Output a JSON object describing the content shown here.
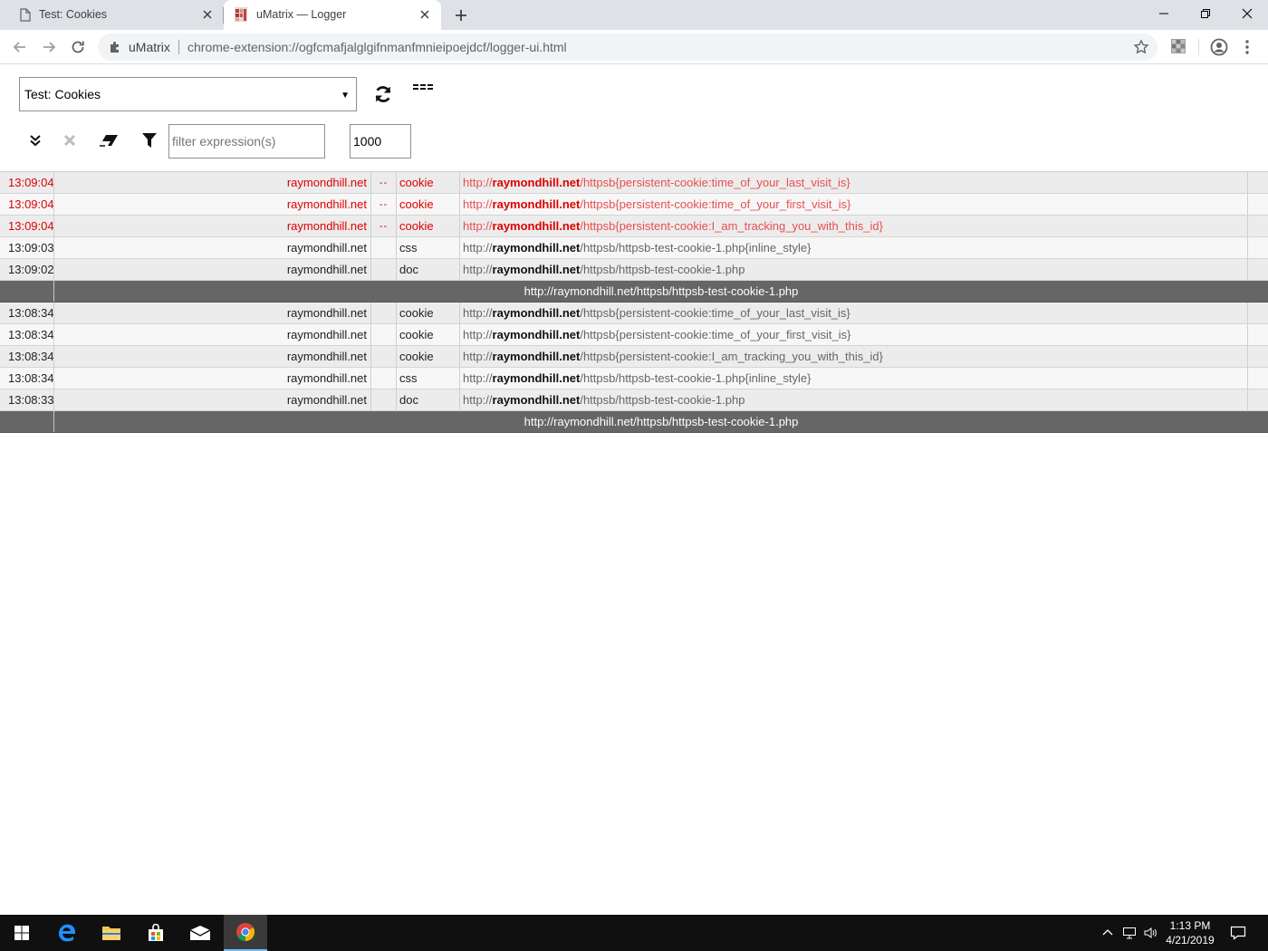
{
  "browser": {
    "tabs": [
      {
        "title": "Test: Cookies",
        "active": false
      },
      {
        "title": "uMatrix — Logger",
        "active": true
      }
    ],
    "omnibox": {
      "site_name": "uMatrix",
      "url": "chrome-extension://ogfcmafjalglgifnmanfmnieipoejdcf/logger-ui.html"
    }
  },
  "logger": {
    "tab_selector": {
      "selected": "Test: Cookies"
    },
    "filter": {
      "placeholder": "filter expression(s)",
      "value": ""
    },
    "max_entries": "1000",
    "rows": [
      {
        "kind": "entry",
        "blocked": true,
        "time": "13:09:04",
        "host": "raymondhill.net",
        "flag": "--",
        "type": "cookie",
        "url_scheme": "http://",
        "url_host": "raymondhill.net",
        "url_path": "/httpsb{persistent-cookie:time_of_your_last_visit_is}"
      },
      {
        "kind": "entry",
        "blocked": true,
        "time": "13:09:04",
        "host": "raymondhill.net",
        "flag": "--",
        "type": "cookie",
        "url_scheme": "http://",
        "url_host": "raymondhill.net",
        "url_path": "/httpsb{persistent-cookie:time_of_your_first_visit_is}"
      },
      {
        "kind": "entry",
        "blocked": true,
        "time": "13:09:04",
        "host": "raymondhill.net",
        "flag": "--",
        "type": "cookie",
        "url_scheme": "http://",
        "url_host": "raymondhill.net",
        "url_path": "/httpsb{persistent-cookie:I_am_tracking_you_with_this_id}"
      },
      {
        "kind": "entry",
        "blocked": false,
        "time": "13:09:03",
        "host": "raymondhill.net",
        "flag": "",
        "type": "css",
        "url_scheme": "http://",
        "url_host": "raymondhill.net",
        "url_path": "/httpsb/httpsb-test-cookie-1.php{inline_style}"
      },
      {
        "kind": "entry",
        "blocked": false,
        "time": "13:09:02",
        "host": "raymondhill.net",
        "flag": "",
        "type": "doc",
        "url_scheme": "http://",
        "url_host": "raymondhill.net",
        "url_path": "/httpsb/httpsb-test-cookie-1.php"
      },
      {
        "kind": "doc",
        "url": "http://raymondhill.net/httpsb/httpsb-test-cookie-1.php"
      },
      {
        "kind": "entry",
        "blocked": false,
        "time": "13:08:34",
        "host": "raymondhill.net",
        "flag": "",
        "type": "cookie",
        "url_scheme": "http://",
        "url_host": "raymondhill.net",
        "url_path": "/httpsb{persistent-cookie:time_of_your_last_visit_is}"
      },
      {
        "kind": "entry",
        "blocked": false,
        "time": "13:08:34",
        "host": "raymondhill.net",
        "flag": "",
        "type": "cookie",
        "url_scheme": "http://",
        "url_host": "raymondhill.net",
        "url_path": "/httpsb{persistent-cookie:time_of_your_first_visit_is}"
      },
      {
        "kind": "entry",
        "blocked": false,
        "time": "13:08:34",
        "host": "raymondhill.net",
        "flag": "",
        "type": "cookie",
        "url_scheme": "http://",
        "url_host": "raymondhill.net",
        "url_path": "/httpsb{persistent-cookie:I_am_tracking_you_with_this_id}"
      },
      {
        "kind": "entry",
        "blocked": false,
        "time": "13:08:34",
        "host": "raymondhill.net",
        "flag": "",
        "type": "css",
        "url_scheme": "http://",
        "url_host": "raymondhill.net",
        "url_path": "/httpsb/httpsb-test-cookie-1.php{inline_style}"
      },
      {
        "kind": "entry",
        "blocked": false,
        "time": "13:08:33",
        "host": "raymondhill.net",
        "flag": "",
        "type": "doc",
        "url_scheme": "http://",
        "url_host": "raymondhill.net",
        "url_path": "/httpsb/httpsb-test-cookie-1.php"
      },
      {
        "kind": "doc",
        "url": "http://raymondhill.net/httpsb/httpsb-test-cookie-1.php"
      }
    ]
  },
  "taskbar": {
    "clock_time": "1:13 PM",
    "clock_date": "4/21/2019"
  },
  "colors": {
    "blocked_text": "#e00000",
    "doc_row_bg": "#666666",
    "tabstrip_bg": "#dee1e6",
    "taskbar_bg": "#101010"
  }
}
